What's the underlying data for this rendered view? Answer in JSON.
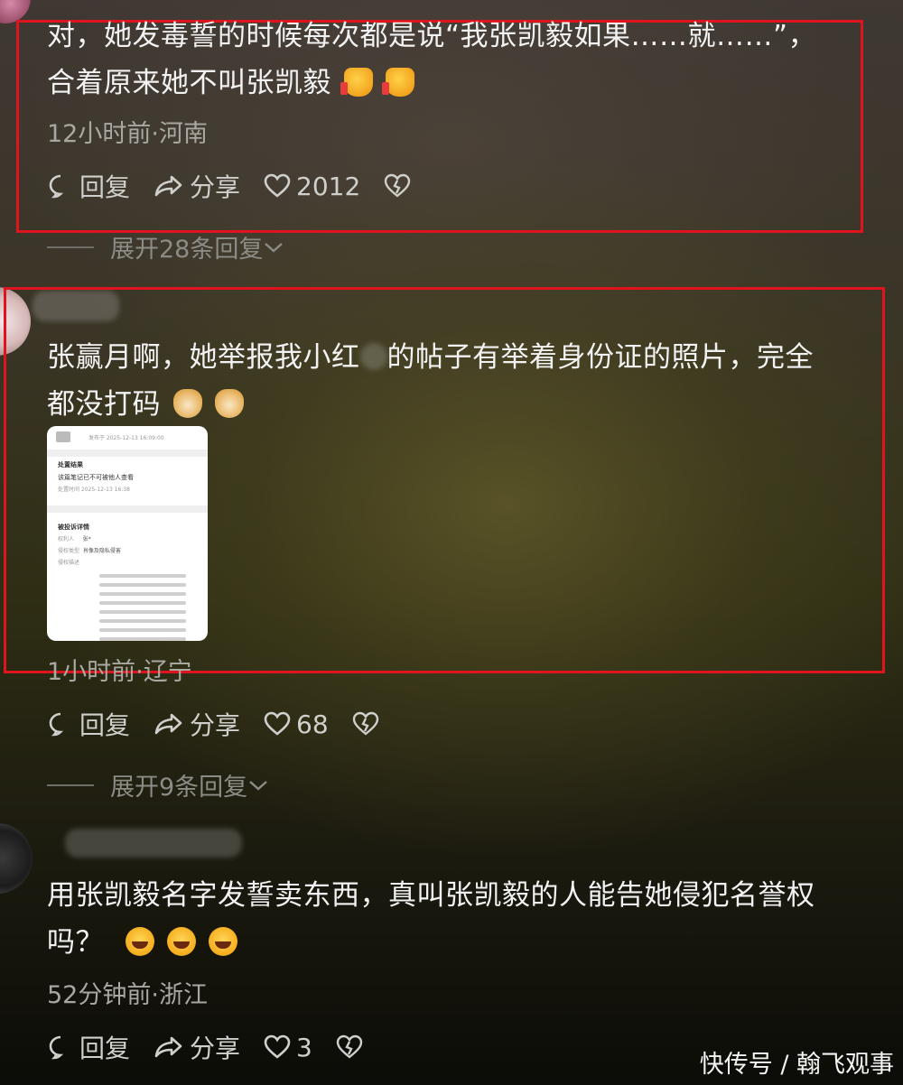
{
  "comments": [
    {
      "text_line1": "对，她发毒誓的时候每次都是说“我张凯毅如果……就……”，",
      "text_line2": "合着原来她不叫张凯毅",
      "emoji": [
        "thumbs-up",
        "thumbs-up"
      ],
      "meta": "12小时前·河南",
      "reply_label": "回复",
      "share_label": "分享",
      "like_count": "2012",
      "expand_label": "展开28条回复"
    },
    {
      "text_line1": "张赢月啊，她举报我小红",
      "text_line1b": "的帖子有举着身份证的照片，完全",
      "text_line2": "都没打码",
      "emoji": [
        "dog-face",
        "dog-face"
      ],
      "screenshot": {
        "header": "发布于 2025-12-13 16:09:00",
        "result_title": "处置结果",
        "result_text": "该篇笔记已不可被他人查看",
        "result_time": "处置时间 2025-12-13 16:38",
        "detail_title": "被投诉详情",
        "row_labels": [
          "权利人",
          "侵权类型",
          "侵权描述"
        ],
        "row_values": [
          "张*",
          "肖像及隐私侵害"
        ]
      },
      "meta": "1小时前·辽宁",
      "reply_label": "回复",
      "share_label": "分享",
      "like_count": "68",
      "expand_label": "展开9条回复"
    },
    {
      "text_line1": "用张凯毅名字发誓卖东西，真叫张凯毅的人能告她侵犯名誉权",
      "text_line2": "吗？",
      "emoji": [
        "laughing-tears",
        "laughing-tears",
        "laughing-tears"
      ],
      "meta": "52分钟前·浙江",
      "reply_label": "回复",
      "share_label": "分享",
      "like_count": "3"
    }
  ],
  "watermark": "快传号 / 翰飞观事",
  "colors": {
    "highlight": "#e0141e",
    "text": "#f2f2f2",
    "meta": "#a8a8a2"
  }
}
